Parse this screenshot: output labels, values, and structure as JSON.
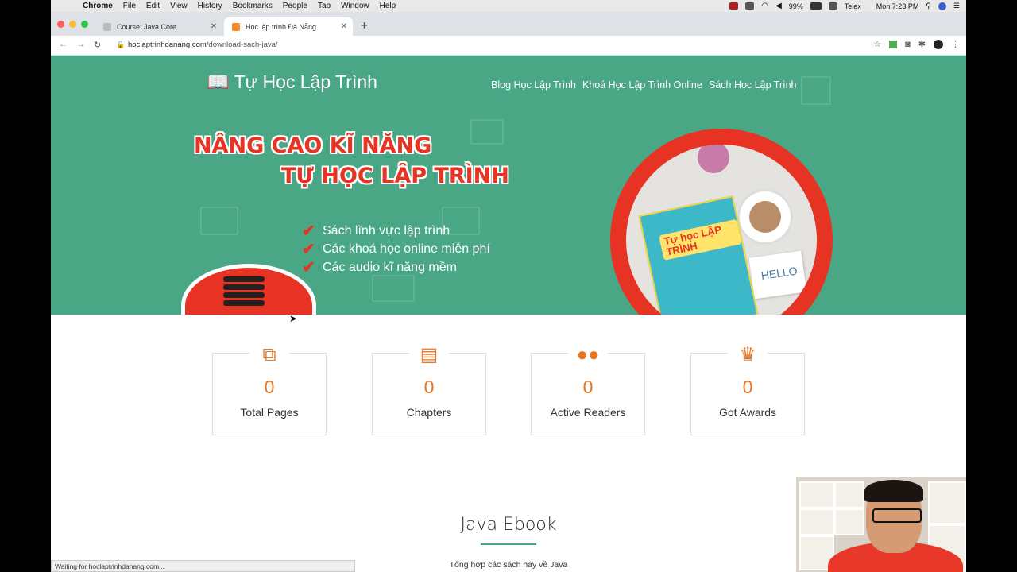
{
  "menubar": {
    "app": "Chrome",
    "items": [
      "File",
      "Edit",
      "View",
      "History",
      "Bookmarks",
      "People",
      "Tab",
      "Window",
      "Help"
    ],
    "battery": "99%",
    "input_method": "Telex",
    "clock": "Mon 7:23 PM"
  },
  "tabs": [
    {
      "title": "Course: Java Core",
      "active": false
    },
    {
      "title": "Học lập trình Đà Nẵng",
      "active": true
    }
  ],
  "address": {
    "domain": "hoclaptrinhdanang.com",
    "path": "/download-sach-java/"
  },
  "site": {
    "logo": "Tự Học Lập Trình",
    "nav": [
      "Blog Học Lập Trình",
      "Khoá Học Lập Trình Online",
      "Sách Học Lập Trình"
    ]
  },
  "hero": {
    "headline1": "NÂNG CAO KĨ NĂNG",
    "headline2": "TỰ HỌC LẬP TRÌNH",
    "bullets": [
      "Sách lĩnh vực lập trình",
      "Các khoá học online miễn phí",
      "Các audio kĩ năng mềm"
    ],
    "book_title": "Tự học LẬP TRÌNH",
    "card_text": "HELLO"
  },
  "stats": [
    {
      "icon": "copy-icon",
      "value": "0",
      "label": "Total Pages"
    },
    {
      "icon": "file-text-icon",
      "value": "0",
      "label": "Chapters"
    },
    {
      "icon": "users-icon",
      "value": "0",
      "label": "Active Readers"
    },
    {
      "icon": "trophy-icon",
      "value": "0",
      "label": "Got Awards"
    }
  ],
  "section": {
    "title": "Java Ebook",
    "subtitle": "Tổng hợp các sách hay về Java"
  },
  "status_bar": "Waiting for hoclaptrinhdanang.com...",
  "colors": {
    "hero_bg": "#4aa785",
    "accent_red": "#e63323",
    "stat_orange": "#e87722"
  }
}
